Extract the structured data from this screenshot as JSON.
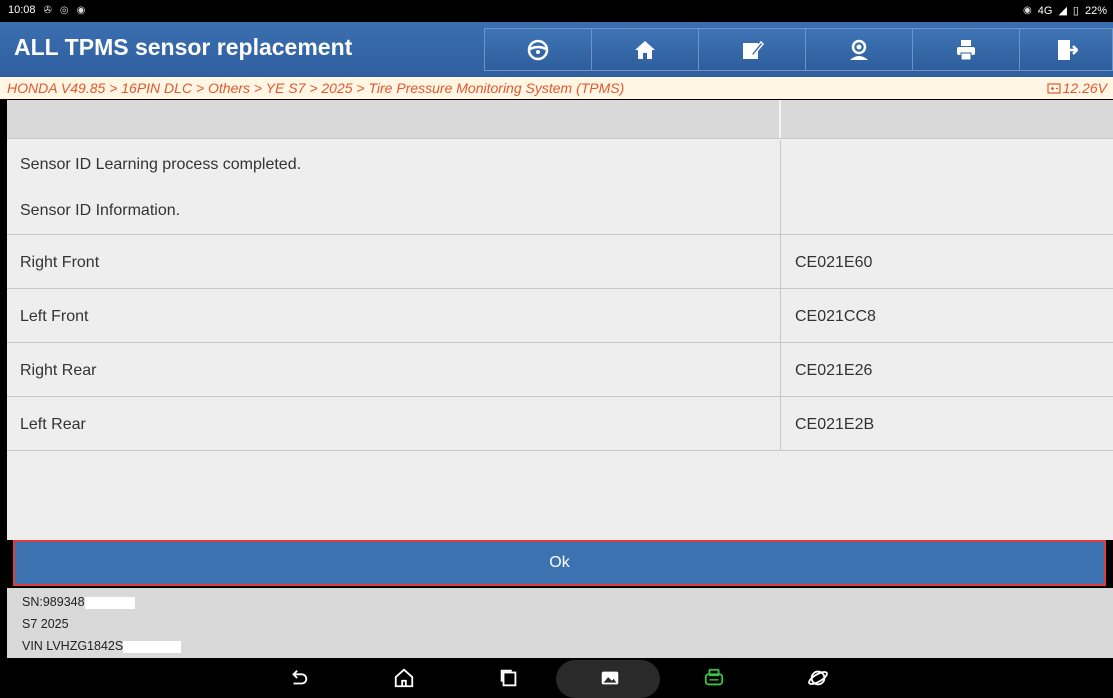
{
  "status_bar": {
    "time": "10:08",
    "network": "4G",
    "battery": "22%"
  },
  "header": {
    "title": "ALL TPMS sensor replacement",
    "buttons": [
      "steering-wheel-icon",
      "home-icon",
      "edit-note-icon",
      "user-support-icon",
      "print-icon",
      "exit-icon"
    ]
  },
  "breadcrumb": {
    "path": "HONDA V49.85 > 16PIN DLC > Others > YE S7 > 2025 > Tire Pressure Monitoring System (TPMS)",
    "voltage": "12.26V"
  },
  "content": {
    "message_line1": "Sensor ID Learning process completed.",
    "message_line2": "Sensor ID Information.",
    "rows": [
      {
        "label": "Right Front",
        "value": "CE021E60"
      },
      {
        "label": "Left Front",
        "value": "CE021CC8"
      },
      {
        "label": "Right Rear",
        "value": "CE021E26"
      },
      {
        "label": "Left Rear",
        "value": "CE021E2B"
      }
    ]
  },
  "actions": {
    "ok_label": "Ok"
  },
  "vehicle_info": {
    "sn": "SN:989348",
    "model": "S7 2025",
    "vin": "VIN LVHZG1842S"
  },
  "colors": {
    "header_blue": "#2f5f9f",
    "breadcrumb_text": "#e4572e",
    "ok_button": "#3d72b1",
    "highlight_border": "#e33a3a"
  }
}
